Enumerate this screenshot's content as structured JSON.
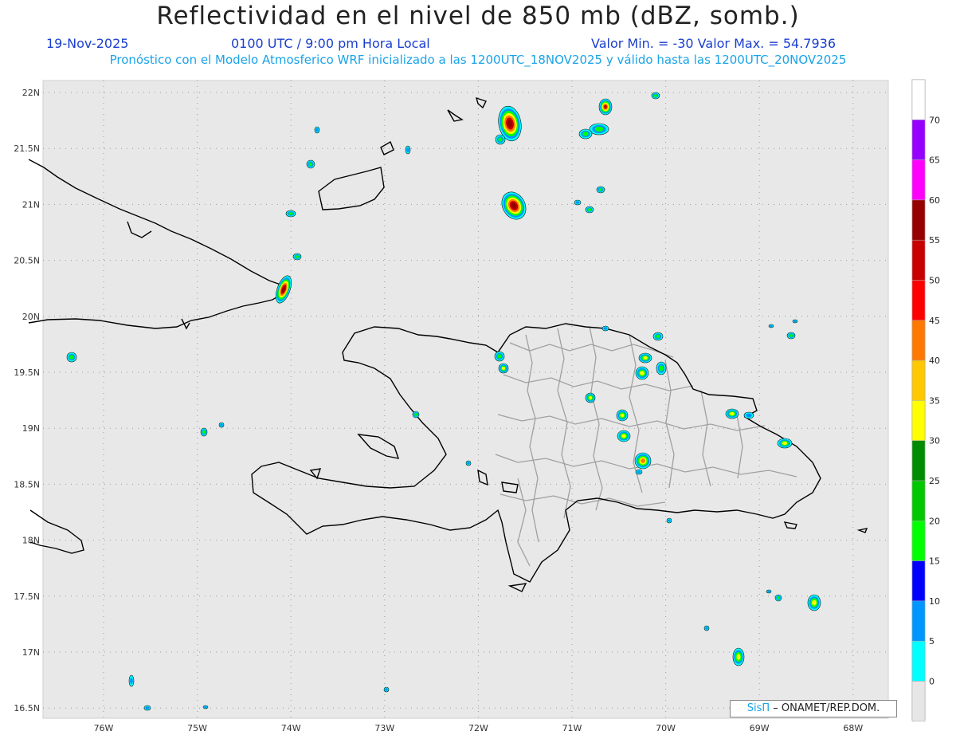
{
  "header": {
    "title": "Reflectividad en el nivel de 850 mb (dBZ, somb.)",
    "date": "19-Nov-2025",
    "time": "0100 UTC / 9:00 pm Hora Local",
    "minmax": "Valor Min. = -30  Valor Max. = 54.7936",
    "model_info": "Pronóstico con el Modelo Atmosferico WRF inicializado a las 1200UTC_18NOV2025 y válido hasta las  1200UTC_20NOV2025"
  },
  "map": {
    "lat_labels": [
      "22N",
      "21.5N",
      "21N",
      "20.5N",
      "20N",
      "19.5N",
      "19N",
      "18.5N",
      "18N",
      "17.5N",
      "17N",
      "16.5N"
    ],
    "lon_labels": [
      "76W",
      "75W",
      "74W",
      "73W",
      "72W",
      "71W",
      "70W",
      "69W",
      "68W"
    ],
    "background_color": "#e8e8e8",
    "coast_color": "#000000",
    "province_color": "#a0a0a0"
  },
  "legend": {
    "labels": [
      "70",
      "65",
      "60",
      "55",
      "50",
      "45",
      "40",
      "35",
      "30",
      "25",
      "20",
      "15",
      "10",
      "5",
      "0"
    ],
    "colors": [
      "#ffffff",
      "#9600ff",
      "#ff00ff",
      "#960000",
      "#c80000",
      "#ff0000",
      "#ff7800",
      "#ffc800",
      "#ffff00",
      "#008c00",
      "#00c800",
      "#00ff00",
      "#0000ff",
      "#0096ff",
      "#00ffff",
      "#e6e6e6"
    ]
  },
  "credit": {
    "brand": "SisΠ",
    "org": "– ONAMET/REP.DOM."
  }
}
